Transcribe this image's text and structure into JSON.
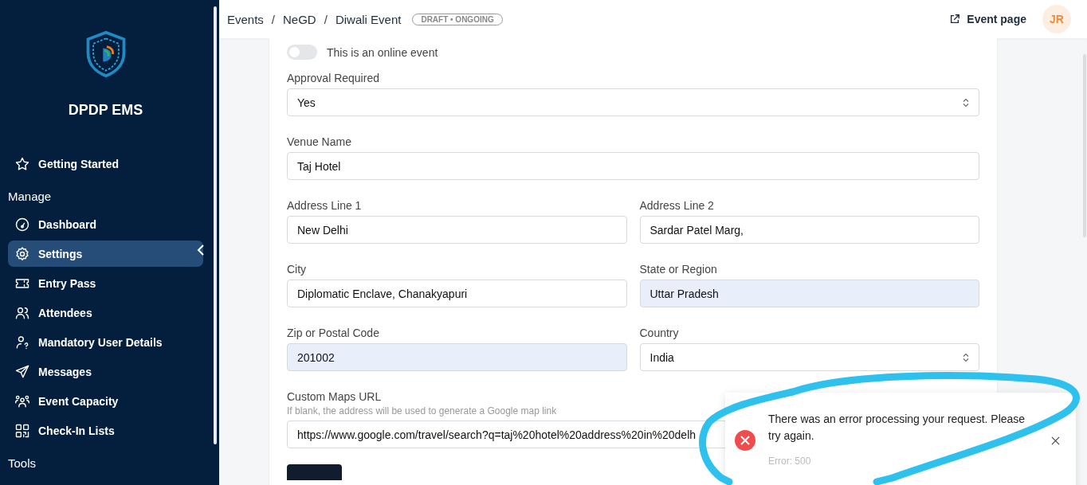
{
  "sidebar": {
    "app_name": "DPDP EMS",
    "groups": [
      {
        "items": [
          {
            "label": "Getting Started",
            "selected": false
          }
        ]
      },
      {
        "heading": "Manage",
        "items": [
          {
            "label": "Dashboard",
            "selected": false
          },
          {
            "label": "Settings",
            "selected": true
          },
          {
            "label": "Entry Pass",
            "selected": false
          },
          {
            "label": "Attendees",
            "selected": false
          },
          {
            "label": "Mandatory User Details",
            "selected": false
          },
          {
            "label": "Messages",
            "selected": false
          },
          {
            "label": "Event Capacity",
            "selected": false
          },
          {
            "label": "Check-In Lists",
            "selected": false
          }
        ]
      },
      {
        "heading": "Tools"
      }
    ]
  },
  "breadcrumb": [
    {
      "text": "Events",
      "kind": "link"
    },
    {
      "text": "/",
      "kind": "separator"
    },
    {
      "text": "NeGD",
      "kind": "link"
    },
    {
      "text": "/",
      "kind": "separator"
    },
    {
      "text": "Diwali Event",
      "kind": "link"
    }
  ],
  "status_badge": "DRAFT • ONGOING",
  "event_page_link": "Event page",
  "avatar_initials": "JR",
  "online_toggle": {
    "label": "This is an online event",
    "on": false
  },
  "rows": [
    [
      {
        "label": "Approval Required",
        "value": "Yes",
        "kind": "select",
        "autofilled": false
      }
    ],
    [
      {
        "label": "Venue Name",
        "value": "Taj Hotel",
        "kind": "text",
        "autofilled": false
      }
    ],
    [
      {
        "label": "Address Line 1",
        "value": "New Delhi",
        "kind": "text",
        "autofilled": false
      },
      {
        "label": "Address Line 2",
        "value": "Sardar Patel Marg,",
        "kind": "text",
        "autofilled": false
      }
    ],
    [
      {
        "label": "City",
        "value": "Diplomatic Enclave, Chanakyapuri",
        "kind": "text",
        "autofilled": false
      },
      {
        "label": "State or Region",
        "value": "Uttar Pradesh",
        "kind": "text",
        "autofilled": true
      }
    ],
    [
      {
        "label": "Zip or Postal Code",
        "value": "201002",
        "kind": "text",
        "autofilled": true
      },
      {
        "label": "Country",
        "value": "India",
        "kind": "select",
        "autofilled": false
      }
    ],
    [
      {
        "label": "Custom Maps URL",
        "hint": "If blank, the address will be used to generate a Google map link",
        "value": "https://www.google.com/travel/search?q=taj%20hotel%20address%20in%20delh",
        "kind": "text",
        "autofilled": false
      }
    ]
  ],
  "toast": {
    "message": "There was an error processing your request. Please try again.",
    "detail": "Error: 500",
    "kind": "error"
  }
}
